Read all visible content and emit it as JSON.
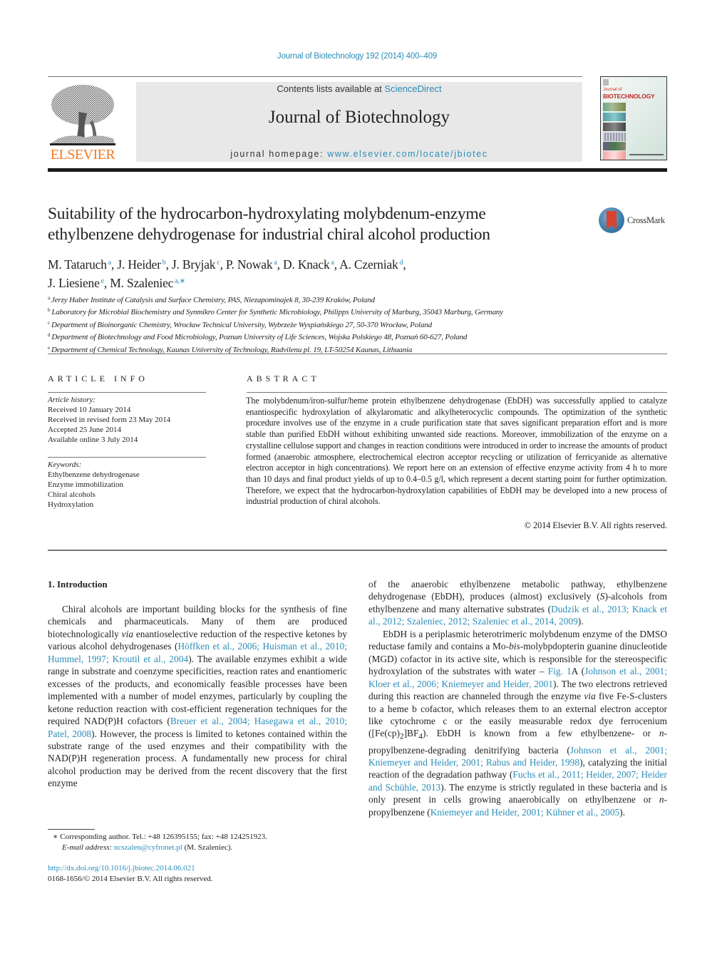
{
  "header": {
    "journal_ref": "Journal of Biotechnology 192 (2014) 400–409",
    "publisher_logo_text": "ELSEVIER",
    "contents_prefix": "Contents lists available at ",
    "contents_link": "ScienceDirect",
    "journal_title": "Journal of Biotechnology",
    "homepage_prefix": "journal homepage: ",
    "homepage_link": "www.elsevier.com/locate/jbiotec",
    "cover_title_small": "Journal of",
    "cover_title": "BIOTECHNOLOGY"
  },
  "article": {
    "title_line1": "Suitability of the hydrocarbon-hydroxylating molybdenum-enzyme",
    "title_line2": "ethylbenzene dehydrogenase for industrial chiral alcohol production",
    "crossmark_label": "CrossMark",
    "authors": [
      {
        "name": "M. Tataruch",
        "aff": "a",
        "sep": ", "
      },
      {
        "name": "J. Heider",
        "aff": "b",
        "sep": ", "
      },
      {
        "name": "J. Bryjak",
        "aff": "c",
        "sep": ", "
      },
      {
        "name": "P. Nowak",
        "aff": "a",
        "sep": ", "
      },
      {
        "name": "D. Knack",
        "aff": "a",
        "sep": ", "
      },
      {
        "name": "A. Czerniak",
        "aff": "d",
        "sep": ","
      },
      {
        "name": "J. Liesiene",
        "aff": "e",
        "sep": ", "
      },
      {
        "name": "M. Szaleniec",
        "aff": "a,∗",
        "sep": ""
      }
    ],
    "affiliations": [
      {
        "key": "a",
        "text": "Jerzy Haber Institute of Catalysis and Surface Chemistry, PAS, Niezapominajek 8, 30-239 Kraków, Poland"
      },
      {
        "key": "b",
        "text": "Laboratory for Microbial Biochemistry and Synmikro Center for Synthetic Microbiology, Philipps University of Marburg, 35043 Marburg, Germany"
      },
      {
        "key": "c",
        "text": "Department of Bioinorganic Chemistry, Wrocław Technical University, Wybrzeże Wyspiańskiego 27, 50-370 Wrocław, Poland"
      },
      {
        "key": "d",
        "text": "Department of Biotechnology and Food Microbiology, Poznan University of Life Sciences, Wojska Polskiego 48, Poznań 60-627, Poland"
      },
      {
        "key": "e",
        "text": "Department of Chemical Technology, Kaunas University of Technology, Radvilenu pl. 19, LT-50254 Kaunas, Lithuania"
      }
    ]
  },
  "article_info": {
    "heading": "ARTICLE INFO",
    "history_label": "Article history:",
    "history": [
      "Received 10 January 2014",
      "Received in revised form 23 May 2014",
      "Accepted 25 June 2014",
      "Available online 3 July 2014"
    ],
    "keywords_label": "Keywords:",
    "keywords": [
      "Ethylbenzene dehydrogenase",
      "Enzyme immobilization",
      "Chiral alcohols",
      "Hydroxylation"
    ]
  },
  "abstract": {
    "heading": "ABSTRACT",
    "text": "The molybdenum/iron-sulfur/heme protein ethylbenzene dehydrogenase (EbDH) was successfully applied to catalyze enantiospecific hydroxylation of alkylaromatic and alkylheterocyclic compounds. The optimization of the synthetic procedure involves use of the enzyme in a crude purification state that saves significant preparation effort and is more stable than purified EbDH without exhibiting unwanted side reactions. Moreover, immobilization of the enzyme on a crystalline cellulose support and changes in reaction conditions were introduced in order to increase the amounts of product formed (anaerobic atmosphere, electrochemical electron acceptor recycling or utilization of ferricyanide as alternative electron acceptor in high concentrations). We report here on an extension of effective enzyme activity from 4 h to more than 10 days and final product yields of up to 0.4–0.5 g/l, which represent a decent starting point for further optimization. Therefore, we expect that the hydrocarbon-hydroxylation capabilities of EbDH may be developed into a new process of industrial production of chiral alcohols.",
    "copyright": "© 2014 Elsevier B.V. All rights reserved."
  },
  "intro": {
    "heading": "1.  Introduction",
    "left_p1": [
      {
        "t": "Chiral alcohols are important building blocks for the synthesis of fine chemicals and pharmaceuticals. Many of them are produced biotechnologically "
      },
      {
        "t": "via",
        "i": true
      },
      {
        "t": " enantioselective reduction of the respective ketones by various alcohol dehydrogenases ("
      },
      {
        "t": "Höffken et al., 2006; Huisman et al., 2010; Hummel, 1997; Kroutil et al., 2004",
        "l": true
      },
      {
        "t": "). The available enzymes exhibit a wide range in substrate and coenzyme specificities, reaction rates and enantiomeric excesses of the products, and economically feasible processes have been implemented with a number of model enzymes, particularly by coupling the ketone reduction reaction with cost-efficient regeneration techniques for the required NAD(P)H cofactors ("
      },
      {
        "t": "Breuer et al., 2004; Hasegawa et al., 2010; Patel, 2008",
        "l": true
      },
      {
        "t": "). However, the process is limited to ketones contained within the substrate range of the used enzymes and their compatibility with the NAD(P)H regeneration process. A fundamentally new process for chiral alcohol production may be derived from the recent discovery that the first enzyme"
      }
    ],
    "right_p1": [
      {
        "t": "of the anaerobic ethylbenzene metabolic pathway, ethylbenzene dehydrogenase (EbDH), produces (almost) exclusively ("
      },
      {
        "t": "S",
        "i": true
      },
      {
        "t": ")-alcohols from ethylbenzene and many alternative substrates ("
      },
      {
        "t": "Dudzik et al., 2013; Knack et al., 2012; Szaleniec, 2012; Szaleniec et al., 2014, 2009",
        "l": true
      },
      {
        "t": ")."
      }
    ],
    "right_p2": [
      {
        "t": "EbDH is a periplasmic heterotrimeric molybdenum enzyme of the DMSO reductase family and contains a Mo-"
      },
      {
        "t": "bis",
        "i": true
      },
      {
        "t": "-molybpdopterin guanine dinucleotide (MGD) cofactor in its active site, which is responsible for the stereospecific hydroxylation of the substrates with water – "
      },
      {
        "t": "Fig. 1",
        "l": true
      },
      {
        "t": "A ("
      },
      {
        "t": "Johnson et al., 2001; Kloer et al., 2006; Kniemeyer and Heider, 2001",
        "l": true
      },
      {
        "t": "). The two electrons retrieved during this reaction are channeled through the enzyme "
      },
      {
        "t": "via",
        "i": true
      },
      {
        "t": " five Fe-S-clusters to a heme b cofactor, which releases them to an external electron acceptor like cytochrome c or the easily measurable redox dye ferrocenium ([Fe(cp)"
      },
      {
        "t": "2",
        "sub": true
      },
      {
        "t": "]BF"
      },
      {
        "t": "4",
        "sub": true
      },
      {
        "t": "). EbDH is known from a few ethylbenzene- or "
      },
      {
        "t": "n",
        "i": true
      },
      {
        "t": "-propylbenzene-degrading denitrifying bacteria ("
      },
      {
        "t": "Johnson et al., 2001; Kniemeyer and Heider, 2001; Rabus and Heider, 1998",
        "l": true
      },
      {
        "t": "), catalyzing the initial reaction of the degradation pathway ("
      },
      {
        "t": "Fuchs et al., 2011; Heider, 2007; Heider and Schühle, 2013",
        "l": true
      },
      {
        "t": "). The enzyme is strictly regulated in these bacteria and is only present in cells growing anaerobically on ethylbenzene or "
      },
      {
        "t": "n",
        "i": true
      },
      {
        "t": "-propylbenzene ("
      },
      {
        "t": "Kniemeyer and Heider, 2001; Kühner et al., 2005",
        "l": true
      },
      {
        "t": ")."
      }
    ]
  },
  "footnotes": {
    "corresponding": "∗  Corresponding author. Tel.: +48 126395155; fax: +48 124251923.",
    "email_label": "E-mail address: ",
    "email": "ncszalen@cyfronet.pl",
    "email_suffix": " (M. Szaleniec).",
    "doi": "http://dx.doi.org/10.1016/j.jbiotec.2014.06.021",
    "issn_line": "0168-1656/© 2014 Elsevier B.V. All rights reserved."
  },
  "colors": {
    "link": "#2a8db8",
    "elsevier_orange": "#f47920",
    "banner_bg": "#e8e8e8"
  }
}
